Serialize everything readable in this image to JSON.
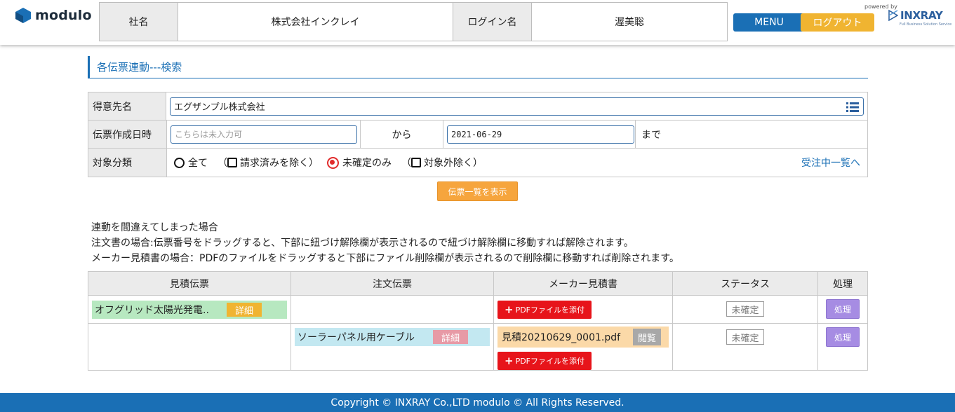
{
  "header": {
    "logo_text": "modulo",
    "company_label": "社名",
    "company_value": "株式会社インクレイ",
    "login_label": "ログイン名",
    "login_value": "渥美聡",
    "menu_label": "MENU",
    "logout_label": "ログアウト",
    "powered_by": "powered by",
    "brand": "INXRAY",
    "brand_sub": "Full Business Solution Service"
  },
  "page_title": "各伝票連動---検索",
  "search": {
    "customer_label": "得意先名",
    "customer_value": "エグザンプル株式会社",
    "date_label": "伝票作成日時",
    "date_from_placeholder": "こちらは未入力可",
    "from_text": "から",
    "date_to_value": "2021-06-29",
    "until_text": "まで",
    "category_label": "対象分類",
    "options": {
      "all": "全て",
      "exclude_billed": "（",
      "exclude_billed_text": "請求済みを除く）",
      "unconfirmed": "未確定のみ",
      "exclude_target_open": "（",
      "exclude_target_text": "対象外除く）"
    },
    "orders_link": "受注中一覧へ",
    "show_button": "伝票一覧を表示"
  },
  "notes": [
    "連動を間違えてしまった場合",
    "注文書の場合:伝票番号をドラッグすると、下部に紐づけ解除欄が表示されるので紐づけ解除欄に移動すれば解除されます。",
    "メーカー見積書の場合：PDFのファイルをドラッグすると下部にファイル削除欄が表示されるので削除欄に移動すれば削除されます。"
  ],
  "table": {
    "headers": [
      "見積伝票",
      "注文伝票",
      "メーカー見積書",
      "ステータス",
      "処理"
    ],
    "rows": [
      {
        "estimate": "オフグリッド太陽光発電..",
        "estimate_tag": "詳細",
        "order": "",
        "pdf_file": "",
        "add_pdf": "PDFファイルを添付",
        "status": "未確定",
        "action": "処理"
      },
      {
        "estimate": "",
        "order": "ソーラーパネル用ケーブル",
        "order_tag": "詳細",
        "pdf_file": "見積20210629_0001.pdf",
        "pdf_tag": "閲覧",
        "add_pdf": "PDFファイルを添付",
        "status": "未確定",
        "action": "処理"
      }
    ]
  },
  "footer": "Copyright © INXRAY Co.,LTD modulo © All Rights Reserved.",
  "colors": {
    "primary": "#1a6fb5",
    "accent_orange": "#f0b431",
    "pdf_red": "#e7141a",
    "process_purple": "#a68ce3"
  }
}
